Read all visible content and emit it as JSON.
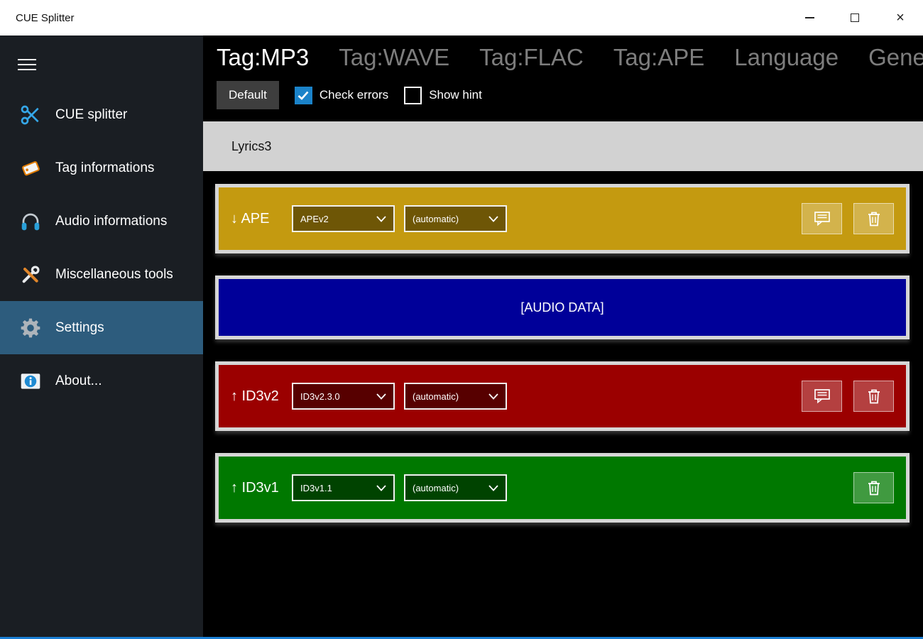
{
  "window": {
    "title": "CUE Splitter"
  },
  "sidebar": {
    "selected_color": "#2d5c7d",
    "items": [
      {
        "label": "CUE splitter",
        "icon": "scissors-icon",
        "selected": false
      },
      {
        "label": "Tag informations",
        "icon": "tag-icon",
        "selected": false
      },
      {
        "label": "Audio informations",
        "icon": "headphones-icon",
        "selected": false
      },
      {
        "label": "Miscellaneous tools",
        "icon": "tools-icon",
        "selected": false
      },
      {
        "label": "Settings",
        "icon": "gear-icon",
        "selected": true
      },
      {
        "label": "About...",
        "icon": "info-icon",
        "selected": false
      }
    ]
  },
  "tabs": [
    {
      "label": "Tag:MP3",
      "active": true
    },
    {
      "label": "Tag:WAVE",
      "active": false
    },
    {
      "label": "Tag:FLAC",
      "active": false
    },
    {
      "label": "Tag:APE",
      "active": false
    },
    {
      "label": "Language",
      "active": false
    },
    {
      "label": "General",
      "active": false
    }
  ],
  "toolbar": {
    "default_button_label": "Default",
    "checkbox_color": "#1b83c9",
    "check_errors": {
      "label": "Check errors",
      "checked": true
    },
    "show_hint": {
      "label": "Show hint",
      "checked": false
    }
  },
  "section_bar": {
    "label": "Lyrics3"
  },
  "tag_rows": [
    {
      "label": "↓ APE",
      "version": "APEv2",
      "mode": "(automatic)",
      "color": "#c49a10",
      "control_color": "#6e5606",
      "buttons": [
        "hint",
        "delete"
      ]
    },
    {
      "label": "↑ ID3v2",
      "version": "ID3v2.3.0",
      "mode": "(automatic)",
      "color": "#9b0000",
      "control_color": "#570000",
      "buttons": [
        "hint",
        "delete"
      ]
    },
    {
      "label": "↑ ID3v1",
      "version": "ID3v1.1",
      "mode": "(automatic)",
      "color": "#007800",
      "control_color": "#004300",
      "buttons": [
        "delete"
      ]
    }
  ],
  "audio_band": {
    "label": "[AUDIO DATA]",
    "color": "#000099"
  }
}
